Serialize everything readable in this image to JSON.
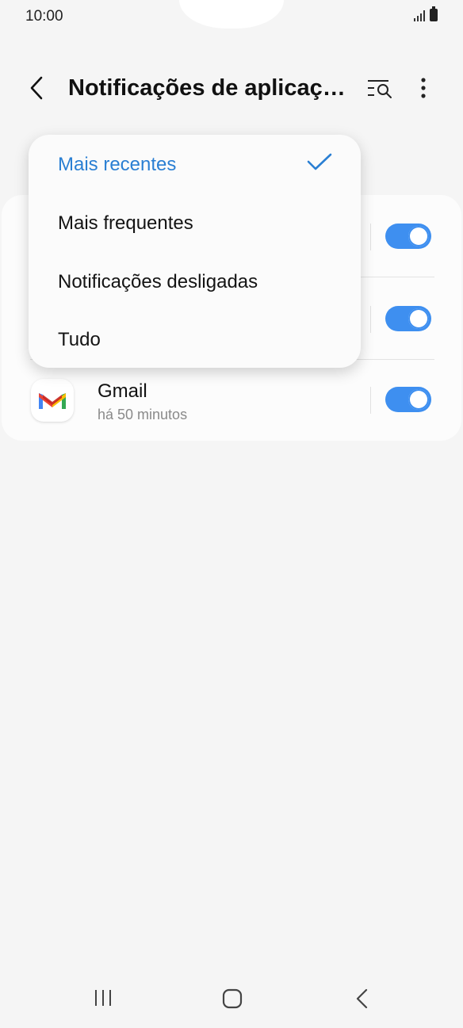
{
  "status_bar": {
    "time": "10:00"
  },
  "app_bar": {
    "title": "Notificações de aplicaç…"
  },
  "sort_menu": {
    "items": [
      {
        "label": "Mais recentes",
        "selected": true
      },
      {
        "label": "Mais frequentes",
        "selected": false
      },
      {
        "label": "Notificações desligadas",
        "selected": false
      },
      {
        "label": "Tudo",
        "selected": false
      }
    ]
  },
  "app_list": [
    {
      "name": "",
      "time": "",
      "enabled": true
    },
    {
      "name": "",
      "time": "",
      "enabled": true
    },
    {
      "name": "Gmail",
      "time": "há 50 minutos",
      "enabled": true
    }
  ],
  "colors": {
    "accent": "#3e8ff0",
    "selected_text": "#2a7fd3",
    "background": "#f5f5f5"
  }
}
